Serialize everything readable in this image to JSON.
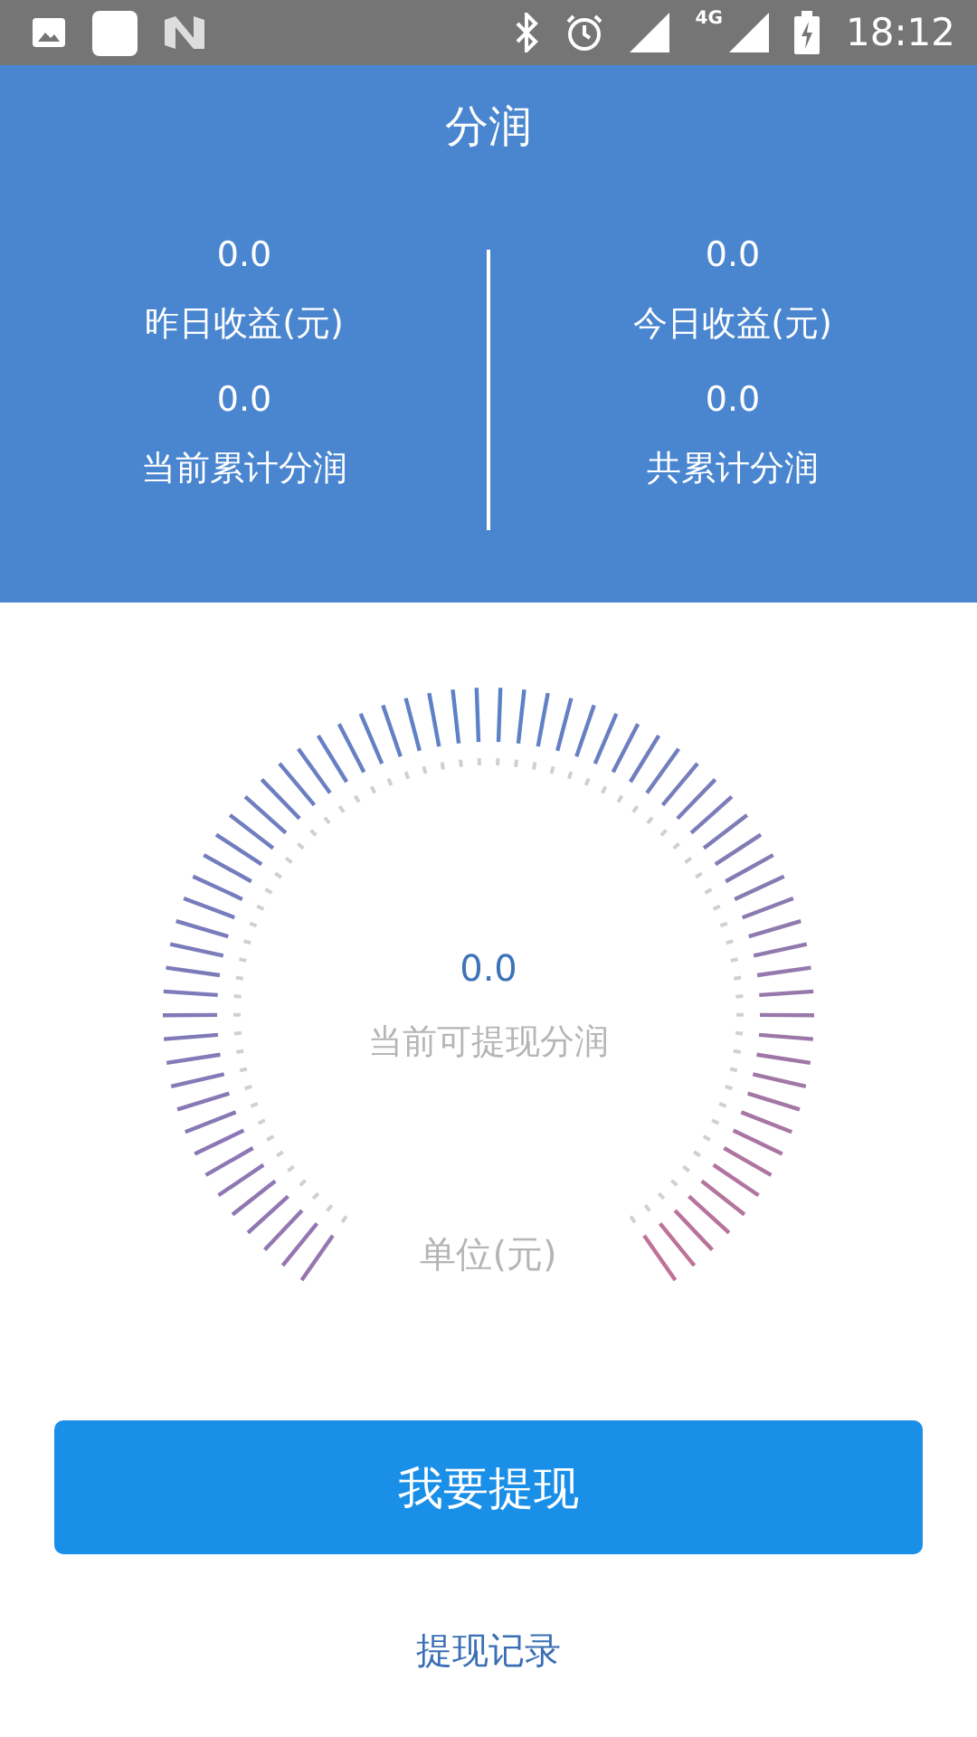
{
  "status_bar": {
    "network_label": "4G",
    "time": "18:12"
  },
  "header": {
    "title": "分润"
  },
  "stats": [
    {
      "value": "0.0",
      "label": "昨日收益(元)"
    },
    {
      "value": "0.0",
      "label": "今日收益(元)"
    },
    {
      "value": "0.0",
      "label": "当前累计分润"
    },
    {
      "value": "0.0",
      "label": "共累计分润"
    }
  ],
  "dial": {
    "value": "0.0",
    "label": "当前可提现分润",
    "unit": "单位(元)"
  },
  "withdraw_button": "我要提现",
  "records_link": "提现记录"
}
